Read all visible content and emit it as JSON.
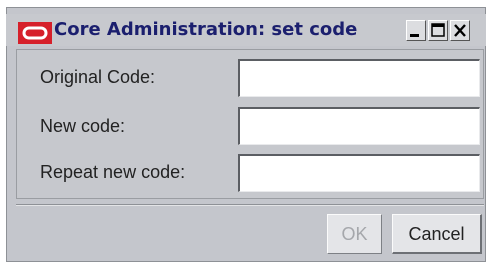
{
  "window": {
    "title": "Core Administration: set code",
    "icon": "oracle-logo-icon",
    "controls": [
      "minimize-icon",
      "maximize-icon",
      "close-icon"
    ]
  },
  "form": {
    "fields": [
      {
        "label": "Original Code:",
        "value": ""
      },
      {
        "label": "New code:",
        "value": ""
      },
      {
        "label": "Repeat new code:",
        "value": ""
      }
    ]
  },
  "buttons": {
    "ok_label": "OK",
    "ok_enabled": false,
    "cancel_label": "Cancel"
  },
  "colors": {
    "title_text": "#1b1f6e",
    "logo_red": "#d6202a",
    "dialog_bg": "#c6c8cd"
  }
}
